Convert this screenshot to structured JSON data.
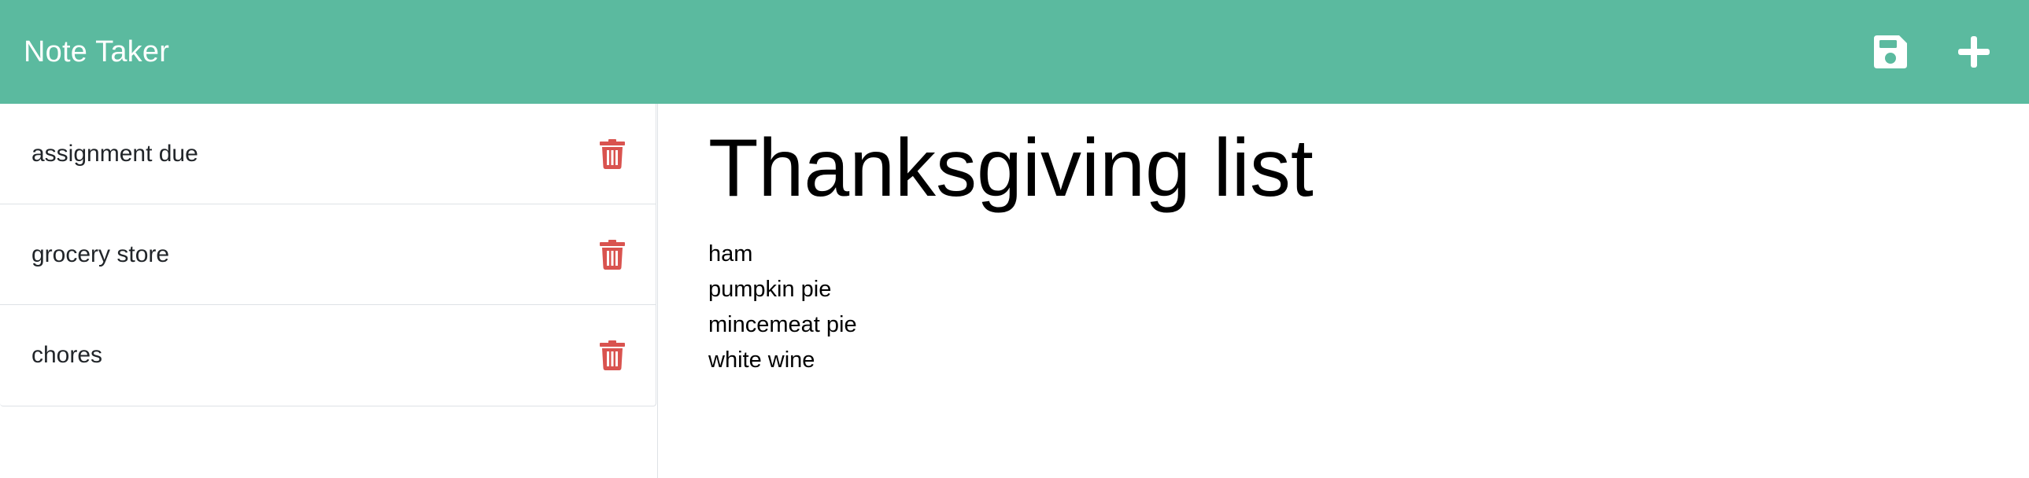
{
  "app": {
    "title": "Note Taker",
    "accent_color": "#5bba9f",
    "delete_color": "#d9534f"
  },
  "header": {
    "icons": [
      "save-icon",
      "plus-icon"
    ]
  },
  "sidebar": {
    "notes": [
      {
        "title": "assignment due"
      },
      {
        "title": "grocery store"
      },
      {
        "title": "chores"
      }
    ]
  },
  "editor": {
    "title": "Thanksgiving list",
    "lines": [
      "ham",
      "pumpkin pie",
      "mincemeat pie",
      "white wine"
    ]
  }
}
